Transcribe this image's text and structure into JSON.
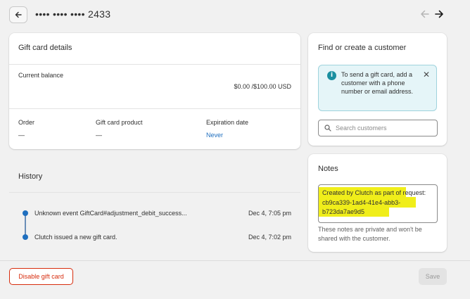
{
  "header": {
    "title": "•••• •••• •••• 2433"
  },
  "gift_card_details": {
    "title": "Gift card details",
    "current_balance_label": "Current balance",
    "balance_value": "$0.00 /$100.00 USD",
    "order_label": "Order",
    "order_value": "—",
    "gift_card_product_label": "Gift card product",
    "gift_card_product_value": "—",
    "expiration_label": "Expiration date",
    "expiration_value": "Never"
  },
  "history": {
    "title": "History",
    "events": [
      {
        "text": "Unknown event GiftCard#adjustment_debit_success...",
        "time": "Dec 4, 7:05 pm"
      },
      {
        "text": "Clutch issued a new gift card.",
        "time": "Dec 4, 7:02 pm"
      }
    ]
  },
  "customer": {
    "title": "Find or create a customer",
    "info_text": "To send a gift card, add a customer with a phone number or email address.",
    "search_placeholder": "Search customers"
  },
  "notes": {
    "title": "Notes",
    "content": "Created by Clutch as part of request:\ncb9ca339-1ad4-41e4-abb3-\nb723da7ae9d5",
    "helper": "These notes are private and won't be shared with the customer."
  },
  "footer": {
    "disable_label": "Disable gift card",
    "save_label": "Save"
  },
  "colors": {
    "accent_link": "#1f6fbf",
    "critical": "#d72c0d",
    "info_bg": "#e5f5f8",
    "highlight": "#f0ee1a"
  },
  "icons": [
    "arrow-left-icon",
    "arrow-left-icon",
    "arrow-right-icon",
    "info-icon",
    "close-icon",
    "search-icon"
  ]
}
